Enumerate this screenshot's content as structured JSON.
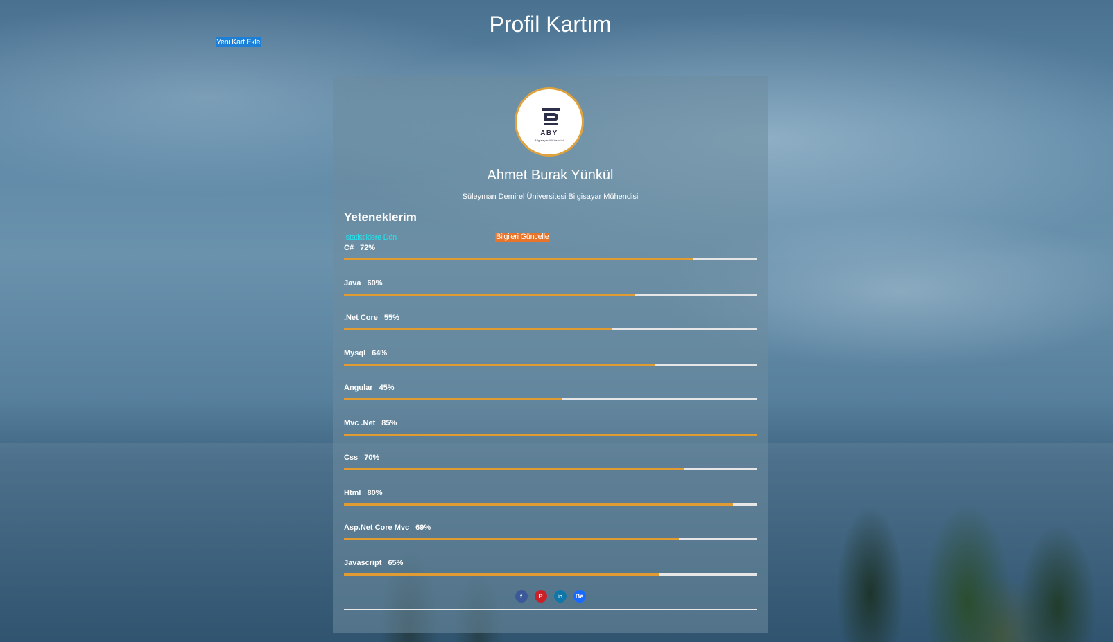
{
  "page": {
    "title": "Profil Kartım"
  },
  "header": {
    "new_card_label": "Yeni Kart Ekle"
  },
  "profile": {
    "avatar": {
      "logo_text": "ABY",
      "logo_subtext": "Bilgisayar Mühendisi"
    },
    "name": "Ahmet Burak Yünkül",
    "subtitle": "Süleyman Demirel Üniversitesi Bilgisayar Mühendisi"
  },
  "skills_section": {
    "heading": "Yeteneklerim",
    "back_link_label": "İstatistiklere Dön",
    "update_button_label": "Bilgileri Güncelle"
  },
  "skills": [
    {
      "name": "C#",
      "percent_label": "72%",
      "fill": 0.846
    },
    {
      "name": "Java",
      "percent_label": "60%",
      "fill": 0.705
    },
    {
      "name": ".Net Core",
      "percent_label": "55%",
      "fill": 0.647
    },
    {
      "name": "Mysql",
      "percent_label": "64%",
      "fill": 0.753
    },
    {
      "name": "Angular",
      "percent_label": "45%",
      "fill": 0.529
    },
    {
      "name": "Mvc .Net",
      "percent_label": "85%",
      "fill": 1.0
    },
    {
      "name": "Css",
      "percent_label": "70%",
      "fill": 0.823
    },
    {
      "name": "Html",
      "percent_label": "80%",
      "fill": 0.941
    },
    {
      "name": "Asp.Net Core Mvc",
      "percent_label": "69%",
      "fill": 0.811
    },
    {
      "name": "Javascript",
      "percent_label": "65%",
      "fill": 0.764
    }
  ],
  "social": [
    {
      "name": "facebook-icon",
      "glyph": "f",
      "color": "#3b5998"
    },
    {
      "name": "pinterest-icon",
      "glyph": "P",
      "color": "#cb2027"
    },
    {
      "name": "linkedin-icon",
      "glyph": "in",
      "color": "#0e76a8"
    },
    {
      "name": "behance-icon",
      "glyph": "Bē",
      "color": "#1769ff"
    }
  ],
  "colors": {
    "accent_bar": "#e09c33",
    "bar_track": "#e6e6e6",
    "new_card_button": "#1e7fd6",
    "update_button": "#e8742a",
    "back_link": "#1fe6f0"
  }
}
